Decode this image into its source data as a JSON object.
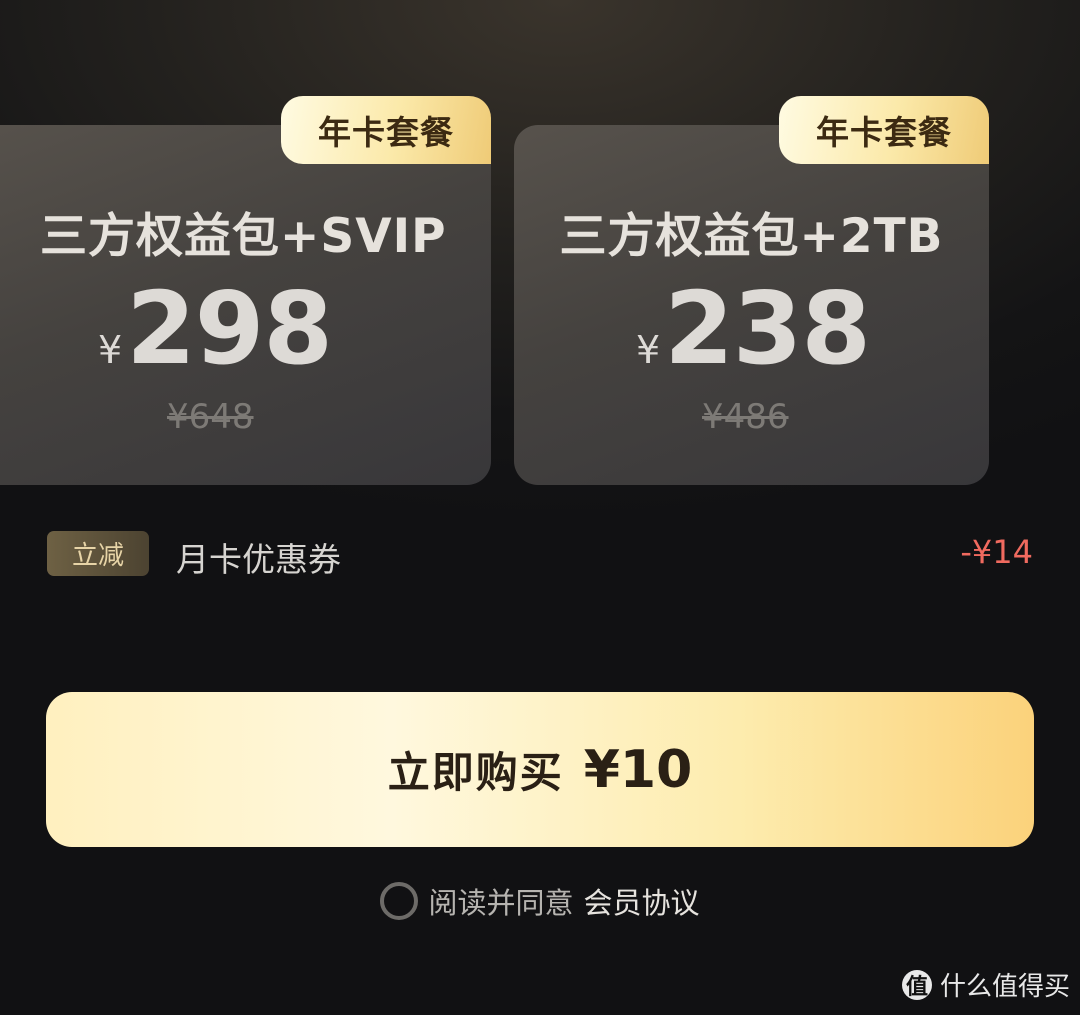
{
  "plans": [
    {
      "tag": "年卡套餐",
      "title": "三方权益包+SVIP",
      "currency": "¥",
      "price": "298",
      "original_price": "¥648"
    },
    {
      "tag": "年卡套餐",
      "title": "三方权益包+2TB",
      "currency": "¥",
      "price": "238",
      "original_price": "¥486"
    }
  ],
  "discount": {
    "badge": "立减",
    "label": "月卡优惠券",
    "amount": "-¥14"
  },
  "buy_button": {
    "label": "立即购买",
    "price": "¥10"
  },
  "agreement": {
    "prefix": "阅读并同意",
    "link": "会员协议"
  },
  "watermark": {
    "logo_char": "值",
    "text": "什么值得买"
  },
  "colors": {
    "accent_gold": "#fbd27b",
    "discount_red": "#f06a5f",
    "background": "#141415"
  }
}
